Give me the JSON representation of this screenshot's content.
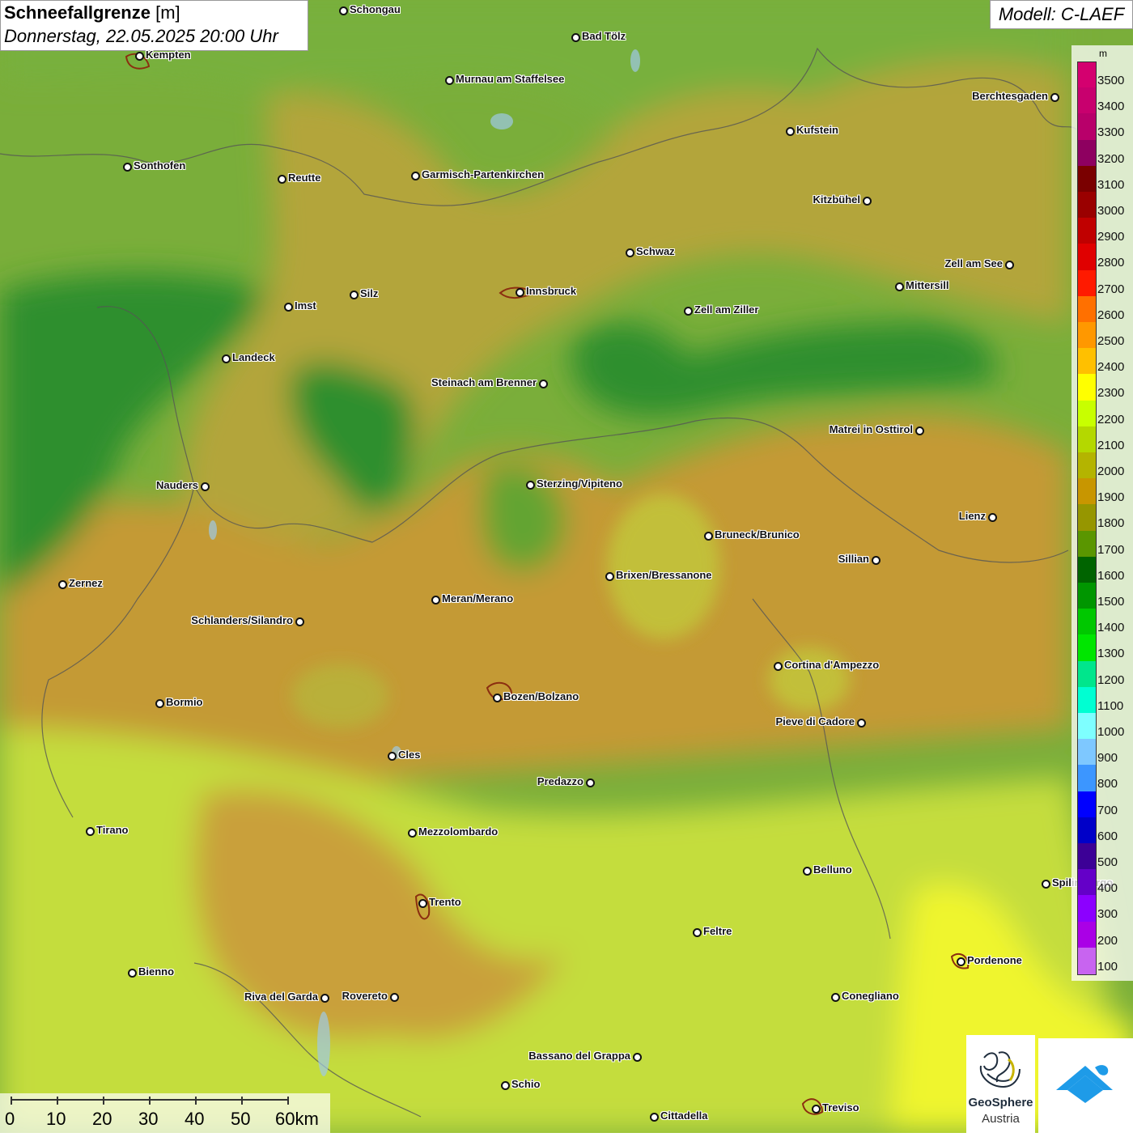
{
  "title": {
    "parameter": "Schneefallgrenze",
    "unit": "[m]",
    "datetime": "Donnerstag, 22.05.2025 20:00 Uhr"
  },
  "model": "Modell: C-LAEF",
  "legend": {
    "unit": "m",
    "entries": [
      {
        "label": "3500",
        "color": "#d4006f"
      },
      {
        "label": "3400",
        "color": "#c8006e"
      },
      {
        "label": "3300",
        "color": "#b8006a"
      },
      {
        "label": "3200",
        "color": "#8e0060"
      },
      {
        "label": "3100",
        "color": "#7a0000"
      },
      {
        "label": "3000",
        "color": "#9a0000"
      },
      {
        "label": "2900",
        "color": "#c00000"
      },
      {
        "label": "2800",
        "color": "#e00000"
      },
      {
        "label": "2700",
        "color": "#ff1a00"
      },
      {
        "label": "2600",
        "color": "#ff7000"
      },
      {
        "label": "2500",
        "color": "#ff9800"
      },
      {
        "label": "2400",
        "color": "#ffc000"
      },
      {
        "label": "2300",
        "color": "#ffff00"
      },
      {
        "label": "2200",
        "color": "#c8ff00"
      },
      {
        "label": "2100",
        "color": "#b4d800"
      },
      {
        "label": "2000",
        "color": "#b4b400"
      },
      {
        "label": "1900",
        "color": "#c89600"
      },
      {
        "label": "1800",
        "color": "#969600"
      },
      {
        "label": "1700",
        "color": "#5a9600"
      },
      {
        "label": "1600",
        "color": "#006400"
      },
      {
        "label": "1500",
        "color": "#009600"
      },
      {
        "label": "1400",
        "color": "#00c800"
      },
      {
        "label": "1300",
        "color": "#00e600"
      },
      {
        "label": "1200",
        "color": "#00e68c"
      },
      {
        "label": "1100",
        "color": "#00ffd2"
      },
      {
        "label": "1000",
        "color": "#7effff"
      },
      {
        "label": "900",
        "color": "#7ec8ff"
      },
      {
        "label": "800",
        "color": "#3c96ff"
      },
      {
        "label": "700",
        "color": "#0000ff"
      },
      {
        "label": "600",
        "color": "#0000c8"
      },
      {
        "label": "500",
        "color": "#3c0096"
      },
      {
        "label": "400",
        "color": "#6400c8"
      },
      {
        "label": "300",
        "color": "#8c00ff"
      },
      {
        "label": "200",
        "color": "#aa00e6"
      },
      {
        "label": "100",
        "color": "#c864f0"
      }
    ]
  },
  "scale": {
    "labels": [
      "0",
      "10",
      "20",
      "30",
      "40",
      "50",
      "60km"
    ]
  },
  "cities": [
    {
      "name": "Schongau"
    },
    {
      "name": "Bad Tölz"
    },
    {
      "name": "Kempten"
    },
    {
      "name": "Murnau am Staffelsee"
    },
    {
      "name": "Berchtesgaden"
    },
    {
      "name": "Kufstein"
    },
    {
      "name": "Sonthofen"
    },
    {
      "name": "Reutte"
    },
    {
      "name": "Garmisch-Partenkirchen"
    },
    {
      "name": "Kitzbühel"
    },
    {
      "name": "Schwaz"
    },
    {
      "name": "Zell am See"
    },
    {
      "name": "Innsbruck"
    },
    {
      "name": "Mittersill"
    },
    {
      "name": "Imst"
    },
    {
      "name": "Silz"
    },
    {
      "name": "Zell am Ziller"
    },
    {
      "name": "Landeck"
    },
    {
      "name": "Steinach am Brenner"
    },
    {
      "name": "Matrei in Osttirol"
    },
    {
      "name": "Nauders"
    },
    {
      "name": "Sterzing/Vipiteno"
    },
    {
      "name": "Lienz"
    },
    {
      "name": "Bruneck/Brunico"
    },
    {
      "name": "Sillian"
    },
    {
      "name": "Zernez"
    },
    {
      "name": "Brixen/Bressanone"
    },
    {
      "name": "Meran/Merano"
    },
    {
      "name": "Schlanders/Silandro"
    },
    {
      "name": "Cortina d'Ampezzo"
    },
    {
      "name": "Bozen/Bolzano"
    },
    {
      "name": "Bormio"
    },
    {
      "name": "Pieve di Cadore"
    },
    {
      "name": "Cles"
    },
    {
      "name": "Predazzo"
    },
    {
      "name": "Tirano"
    },
    {
      "name": "Mezzolombardo"
    },
    {
      "name": "Belluno"
    },
    {
      "name": "Spilimbergo"
    },
    {
      "name": "Trento"
    },
    {
      "name": "Feltre"
    },
    {
      "name": "Pordenone"
    },
    {
      "name": "Bienno"
    },
    {
      "name": "Riva del Garda"
    },
    {
      "name": "Rovereto"
    },
    {
      "name": "Conegliano"
    },
    {
      "name": "Bassano del Grappa"
    },
    {
      "name": "Schio"
    },
    {
      "name": "Treviso"
    },
    {
      "name": "Cittadella"
    }
  ],
  "logo": {
    "text1": "GeoSphere",
    "text2": "Austria"
  },
  "colors": {
    "green_low": "#2e8b2e",
    "green_mid": "#6aa52a",
    "olive": "#b4a832",
    "ochre": "#c89a2e",
    "yellow_green": "#c8e632",
    "yellow": "#f0f030"
  }
}
